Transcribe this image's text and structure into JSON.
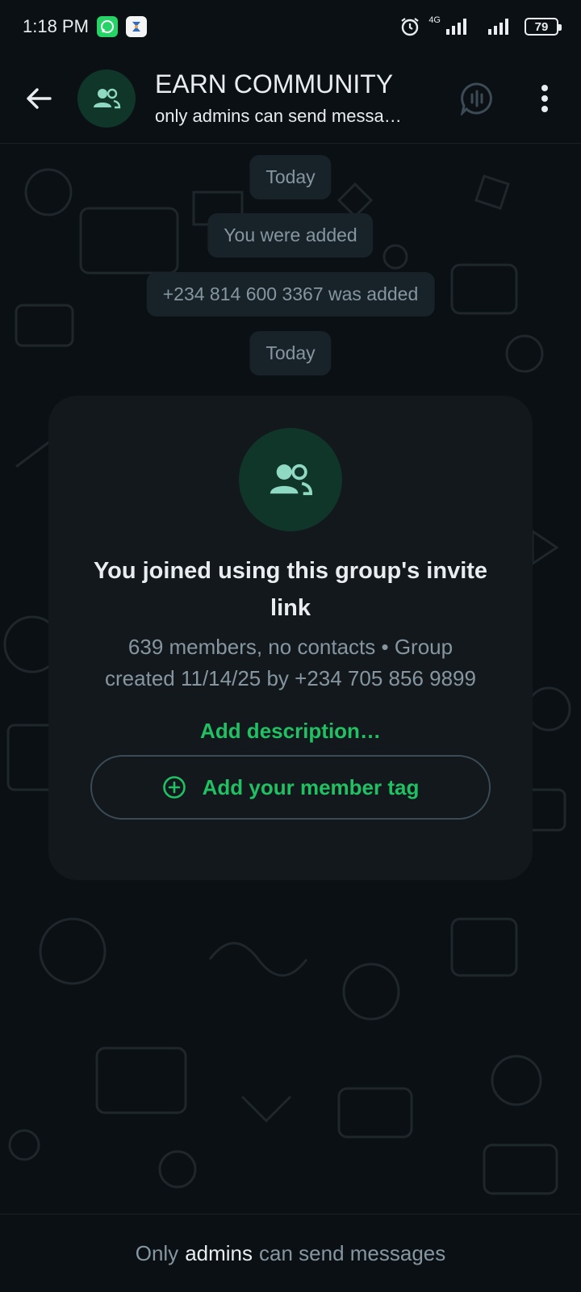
{
  "status_bar": {
    "time": "1:18 PM",
    "network_label": "4G",
    "battery": "79",
    "icons": [
      "whatsapp-notification-icon",
      "app-notification-icon",
      "alarm-icon",
      "signal-4g-icon",
      "signal-icon",
      "battery-icon"
    ]
  },
  "header": {
    "title": "EARN COMMUNITY",
    "subtitle": "only admins can send messa…",
    "icons": [
      "back-arrow-icon",
      "group-avatar-icon",
      "voice-chat-icon",
      "more-vertical-icon"
    ]
  },
  "chat": {
    "system_messages": [
      {
        "text": "Today"
      },
      {
        "text": "You were added"
      },
      {
        "text": "+234 814 600 3367 was added"
      },
      {
        "text": "Today"
      }
    ],
    "invite_card": {
      "title": "You joined using this group's invite link",
      "meta": "639 members, no contacts • Group created 11/14/25 by +234 705 856 9899",
      "add_description_label": "Add description…",
      "member_tag_label": "Add your member tag"
    }
  },
  "footer": {
    "text_before": "Only",
    "text_highlight": "admins",
    "text_after": "can send messages"
  },
  "colors": {
    "background": "#0b1014",
    "accent_green": "#21c063",
    "avatar_bg": "#103529",
    "avatar_fg": "#8fd9c3",
    "pill_bg": "#182229",
    "muted_text": "#8696a0"
  }
}
